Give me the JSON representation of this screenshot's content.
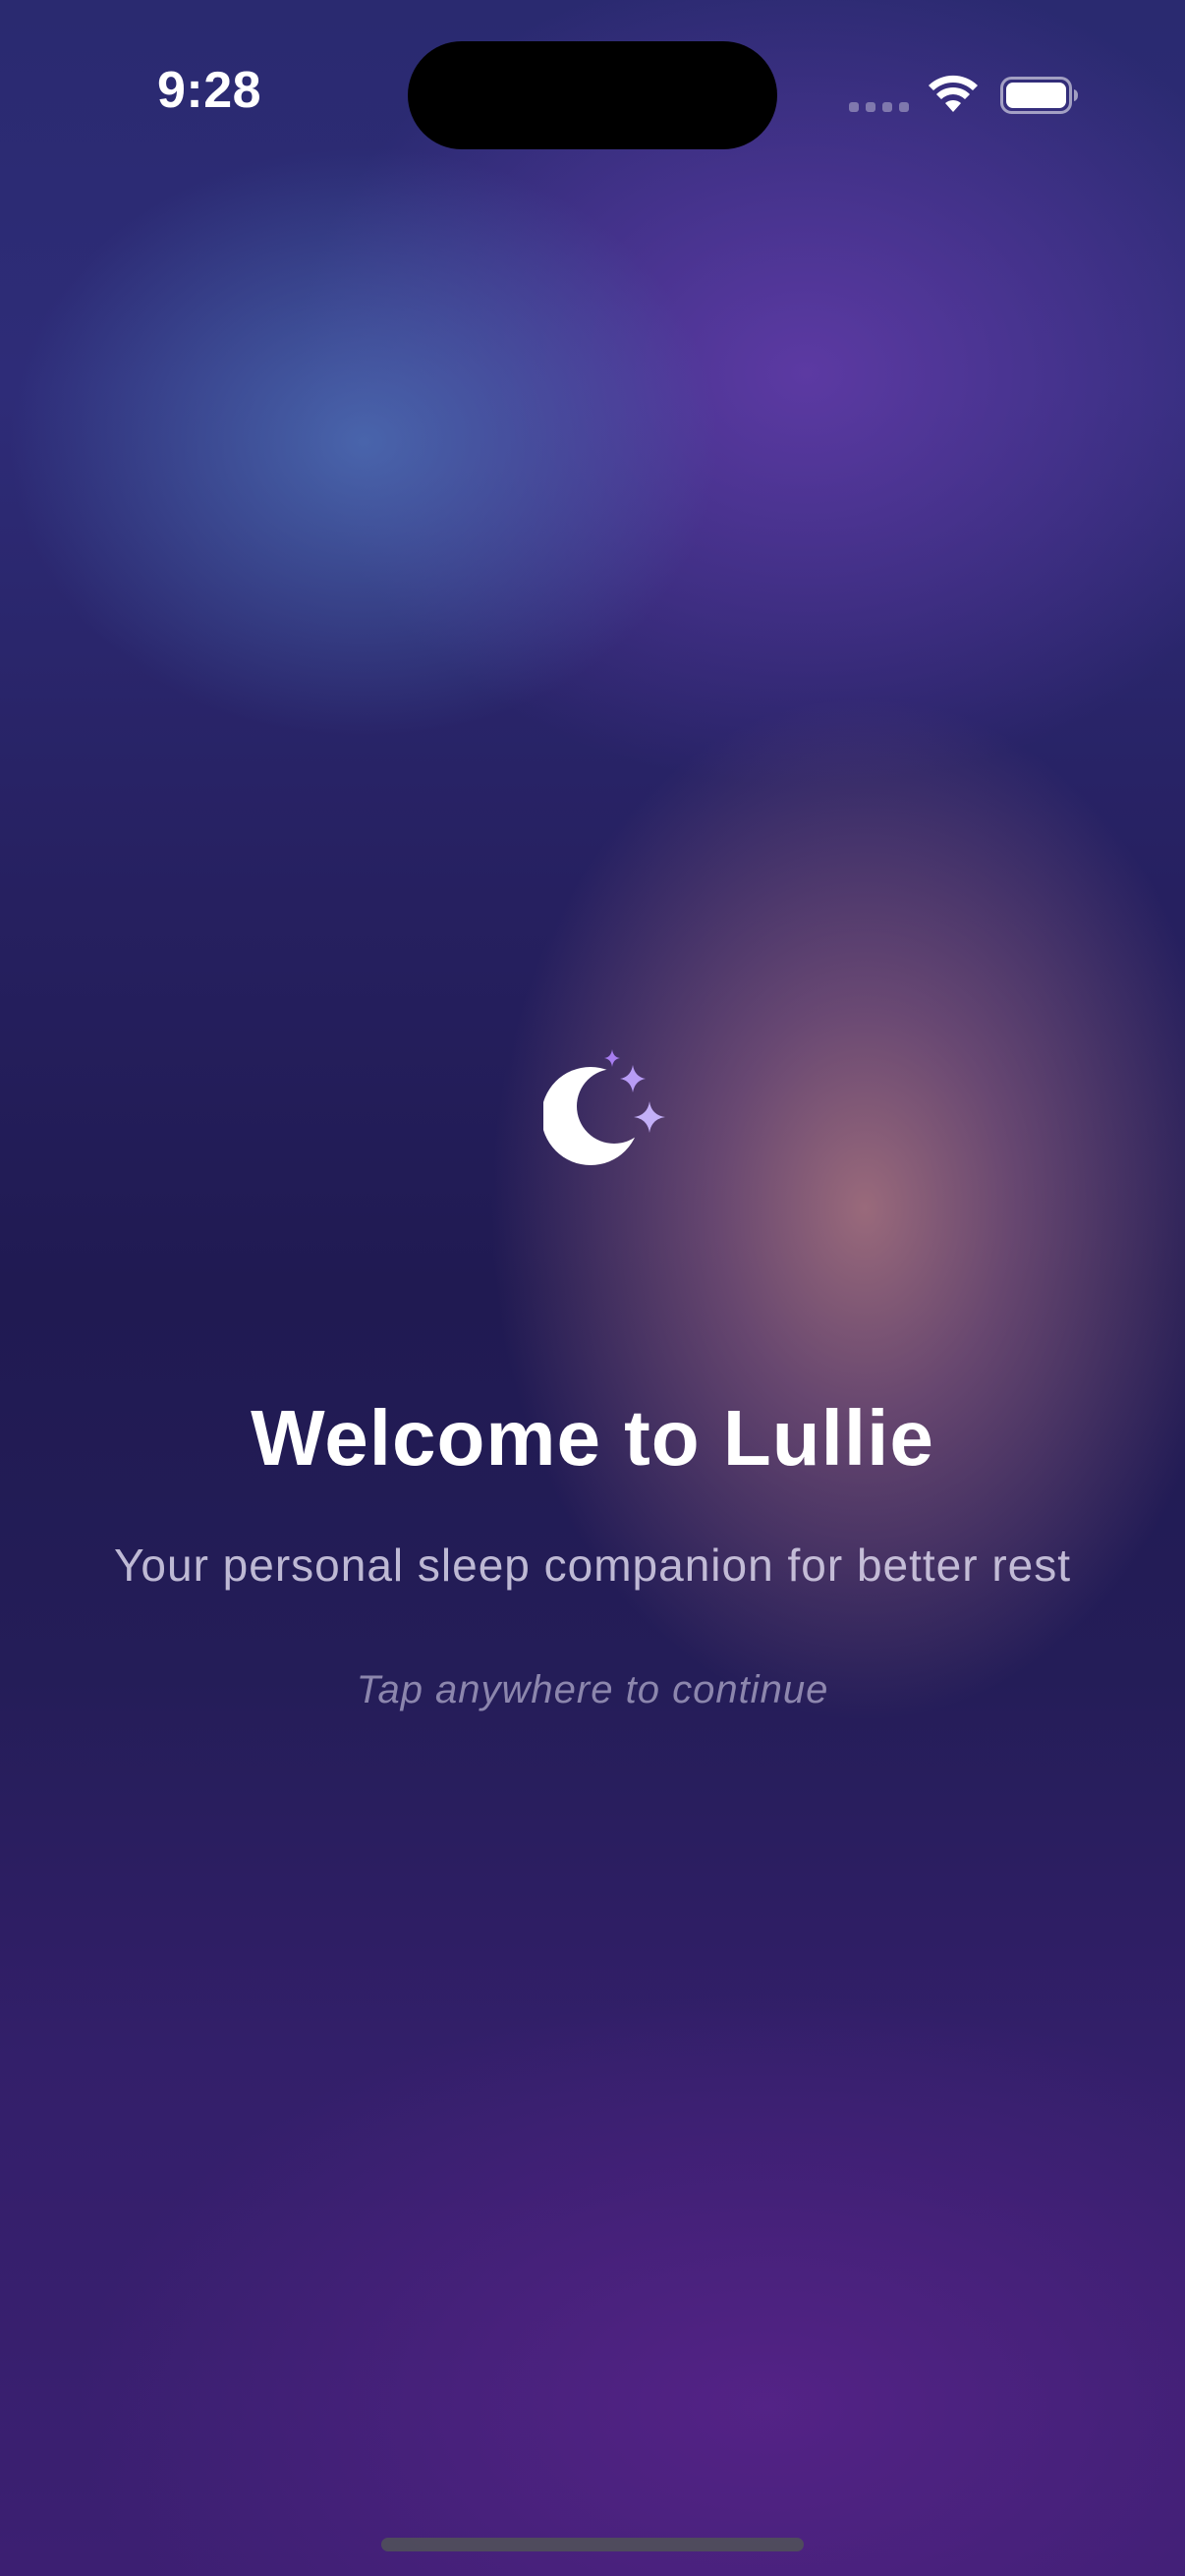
{
  "status_bar": {
    "time": "9:28"
  },
  "icons": {
    "signal": "cellular-signal-icon",
    "wifi": "wifi-icon",
    "battery": "battery-icon",
    "logo": "moon-sparkles-icon"
  },
  "colors": {
    "moon": "#ffffff",
    "sparkles": "#b89cf5",
    "background_top": "#2a2a70",
    "background_bottom": "#3c1f72"
  },
  "welcome": {
    "title": "Welcome to Lullie",
    "subtitle": "Your personal sleep companion for better rest",
    "hint": "Tap anywhere to continue"
  }
}
